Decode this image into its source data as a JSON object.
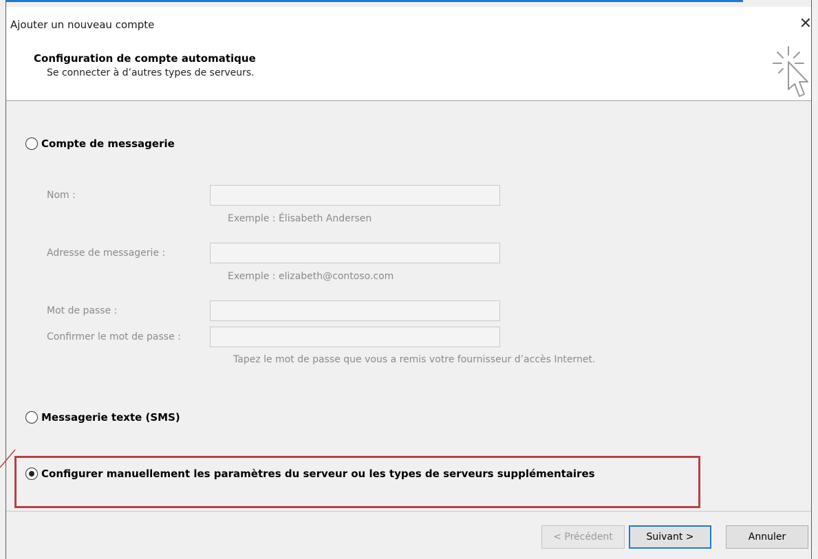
{
  "window": {
    "title": "Ajouter un nouveau compte",
    "close_glyph": "✕"
  },
  "header": {
    "title": "Configuration de compte automatique",
    "subtitle": "Se connecter à d’autres types de serveurs.",
    "icon": "wizard-cursor-icon"
  },
  "options": {
    "email_account": {
      "label": "Compte de messagerie",
      "selected": false
    },
    "sms": {
      "label": "Messagerie texte (SMS)",
      "selected": false
    },
    "manual": {
      "label": "Configurer manuellement les paramètres du serveur ou les types de serveurs supplémentaires",
      "selected": true
    }
  },
  "form": {
    "name": {
      "label": "Nom :",
      "value": "",
      "hint": "Exemple : Élisabeth Andersen"
    },
    "email": {
      "label": "Adresse de messagerie :",
      "value": "",
      "hint": "Exemple : elizabeth@contoso.com"
    },
    "password": {
      "label": "Mot de passe :",
      "value": ""
    },
    "confirm_password": {
      "label": "Confirmer le mot de passe :",
      "value": "",
      "hint": "Tapez le mot de passe que vous a remis votre fournisseur d’accès Internet."
    }
  },
  "footer": {
    "previous_label": "< Précédent",
    "next_label": "Suivant >",
    "cancel_label": "Annuler"
  },
  "colors": {
    "highlight_border": "#b64244",
    "accent": "#1c7ad1"
  }
}
